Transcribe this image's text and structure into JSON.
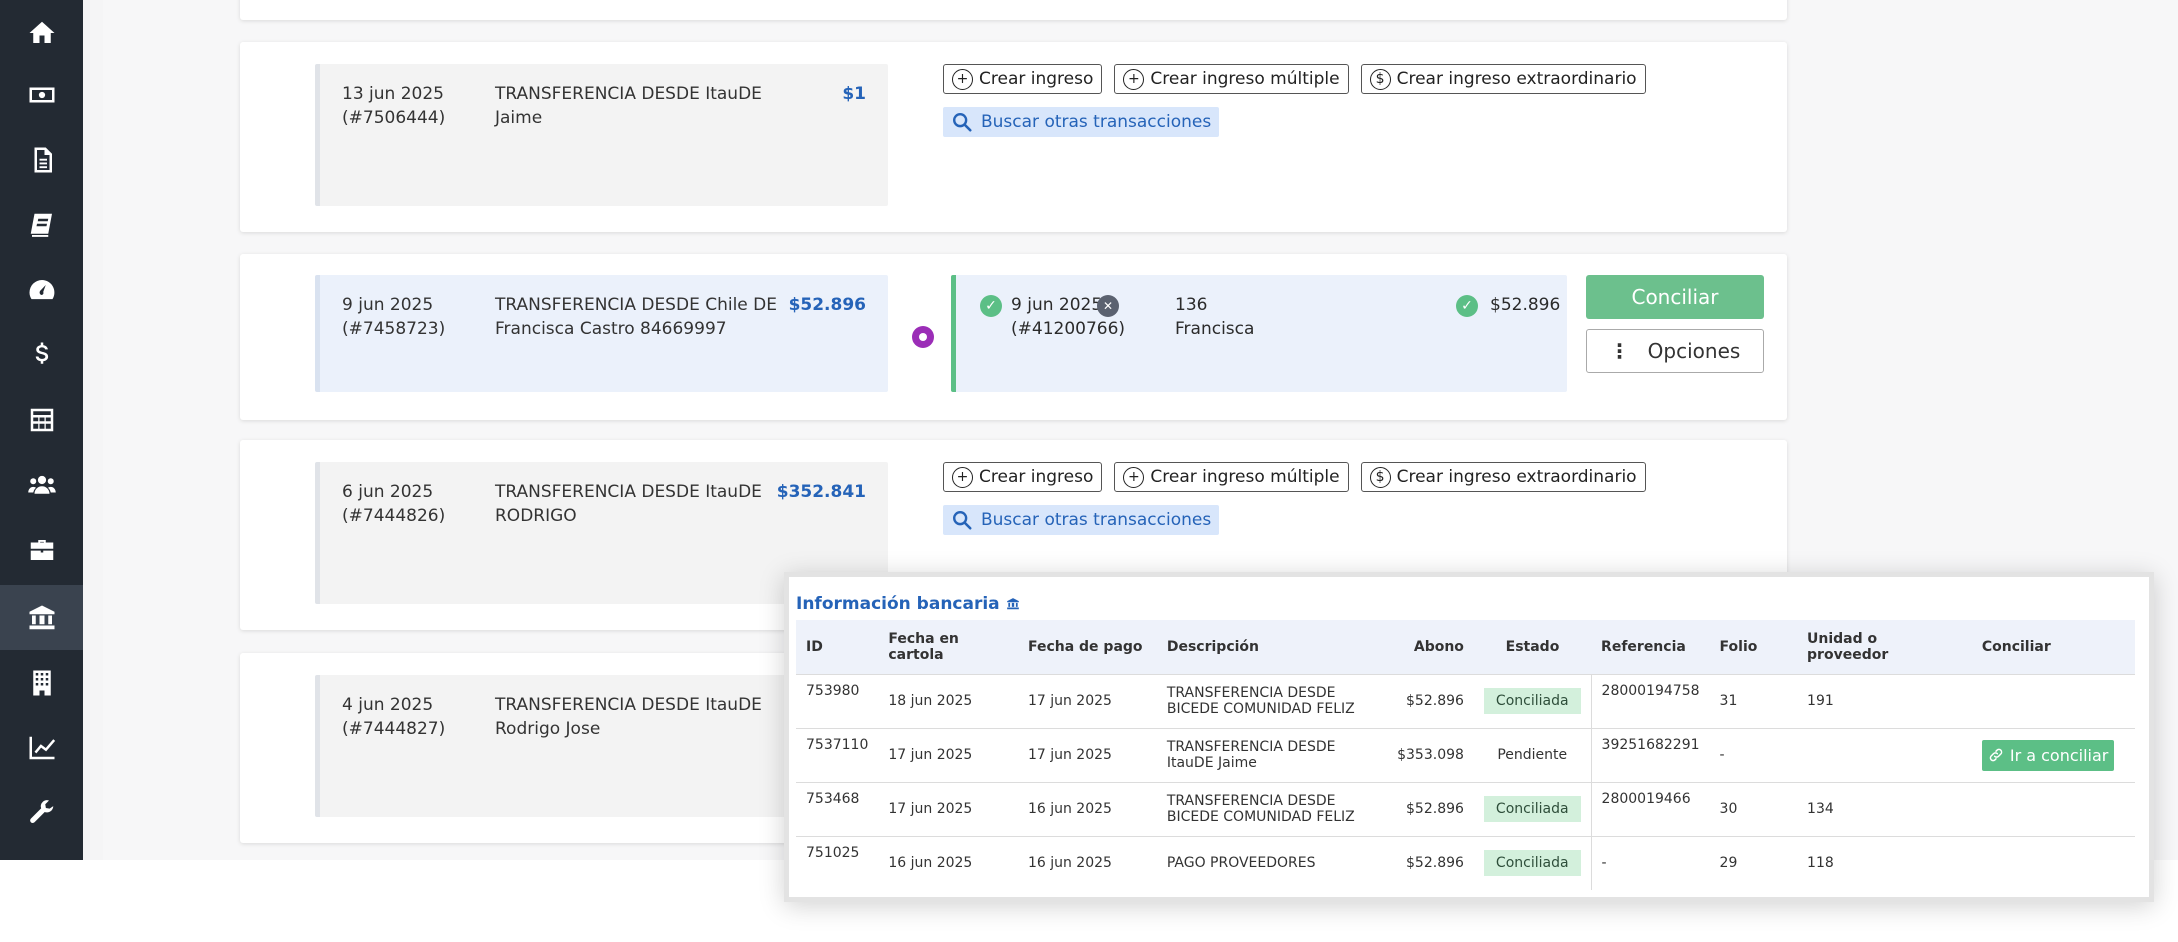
{
  "sidebar": {
    "items": [
      {
        "icon": "home-icon"
      },
      {
        "icon": "money-icon"
      },
      {
        "icon": "document-icon"
      },
      {
        "icon": "book-icon"
      },
      {
        "icon": "dashboard-icon"
      },
      {
        "icon": "dollar-icon"
      },
      {
        "icon": "calculator-icon"
      },
      {
        "icon": "users-icon"
      },
      {
        "icon": "briefcase-icon"
      },
      {
        "icon": "bank-icon",
        "active": true
      },
      {
        "icon": "building-icon"
      },
      {
        "icon": "chart-icon"
      },
      {
        "icon": "wrench-icon"
      }
    ]
  },
  "actions": {
    "crear_ingreso": "Crear ingreso",
    "crear_multiple": "Crear ingreso múltiple",
    "crear_extra": "Crear ingreso extraordinario",
    "buscar": "Buscar otras transacciones",
    "conciliar": "Conciliar",
    "opciones": "Opciones"
  },
  "cards": [
    {
      "date": "13 jun 2025",
      "id": "(#7506444)",
      "desc": "TRANSFERENCIA DESDE ItauDE Jaime",
      "amount": "$1"
    },
    {
      "date": "9 jun 2025",
      "id": "(#7458723)",
      "desc": "TRANSFERENCIA DESDE Chile DE Francisca Castro 84669997",
      "amount": "$52.896",
      "match": {
        "date": "9 jun 2025",
        "id": "(#41200766)",
        "unit": "136",
        "name": "Francisca",
        "amount": "$52.896"
      }
    },
    {
      "date": "6 jun 2025",
      "id": "(#7444826)",
      "desc": "TRANSFERENCIA DESDE ItauDE RODRIGO",
      "amount": "$352.841"
    },
    {
      "date": "4 jun 2025",
      "id": "(#7444827)",
      "desc": "TRANSFERENCIA DESDE ItauDE Rodrigo Jose",
      "amount": ""
    }
  ],
  "popup": {
    "title": "Información bancaria",
    "columns": [
      "ID",
      "Fecha en cartola",
      "Fecha de pago",
      "Descripción",
      "Abono",
      "Estado",
      "Referencia",
      "Folio",
      "Unidad o proveedor",
      "Conciliar"
    ],
    "rows": [
      {
        "id": "753980",
        "fecha_cartola": "18 jun 2025",
        "fecha_pago": "17 jun 2025",
        "desc": "TRANSFERENCIA DESDE BICEDE COMUNIDAD FELIZ",
        "abono": "$52.896",
        "estado": "Conciliada",
        "ref": "28000194758",
        "folio": "31",
        "unidad": "191",
        "conciliar": ""
      },
      {
        "id": "7537110",
        "fecha_cartola": "17 jun 2025",
        "fecha_pago": "17 jun 2025",
        "desc": "TRANSFERENCIA DESDE ItauDE Jaime",
        "abono": "$353.098",
        "estado": "Pendiente",
        "ref": "39251682291",
        "folio": "-",
        "unidad": "",
        "conciliar": "Ir a conciliar"
      },
      {
        "id": "753468",
        "fecha_cartola": "17 jun 2025",
        "fecha_pago": "16 jun 2025",
        "desc": "TRANSFERENCIA DESDE BICEDE COMUNIDAD FELIZ",
        "abono": "$52.896",
        "estado": "Conciliada",
        "ref": "2800019466",
        "folio": "30",
        "unidad": "134",
        "conciliar": ""
      },
      {
        "id": "751025",
        "fecha_cartola": "16 jun 2025",
        "fecha_pago": "16 jun 2025",
        "desc": "PAGO PROVEEDORES",
        "abono": "$52.896",
        "estado": "Conciliada",
        "ref": "-",
        "folio": "29",
        "unidad": "118",
        "conciliar": ""
      }
    ]
  }
}
